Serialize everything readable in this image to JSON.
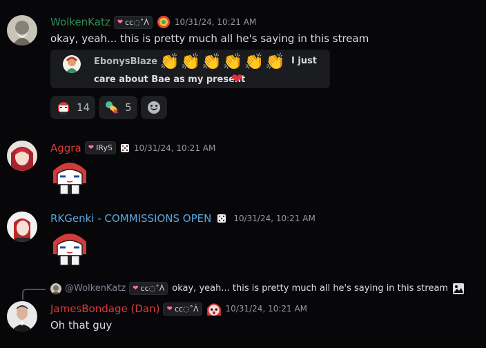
{
  "messages": [
    {
      "username": "WolkenKatz",
      "name_color": "#2e8b57",
      "tag": "cc◌˚ᐲ",
      "timestamp": "10/31/24, 10:21 AM",
      "text": "okay, yeah... this is pretty much all he's saying in this stream",
      "embed": {
        "author": "EbonysBlaze",
        "claps": "👏👏👏👏👏👏",
        "text_line1": "I just",
        "text_line2": "care about Bae as my present"
      },
      "reactions": [
        {
          "icon": "chibi-sticker-icon",
          "count": "14"
        },
        {
          "icon": "pill-emoji-icon",
          "count": "5"
        }
      ]
    },
    {
      "username": "Aggra",
      "name_color": "#e03a3a",
      "tag": "IRyS",
      "timestamp": "10/31/24, 10:21 AM"
    },
    {
      "username": "RKGenki - COMMISSIONS OPEN",
      "name_color": "#5aa7e0",
      "timestamp": "10/31/24, 10:21 AM"
    },
    {
      "reply": {
        "mention": "@WolkenKatz",
        "tag": "cc◌˚ᐲ",
        "text": "okay, yeah... this is pretty much all he's saying in this stream"
      },
      "username": "JamesBondage (Dan)",
      "name_color": "#e03a3a",
      "tag": "cc◌˚ᐲ",
      "timestamp": "10/31/24, 10:21 AM",
      "text": "Oh that guy"
    }
  ]
}
